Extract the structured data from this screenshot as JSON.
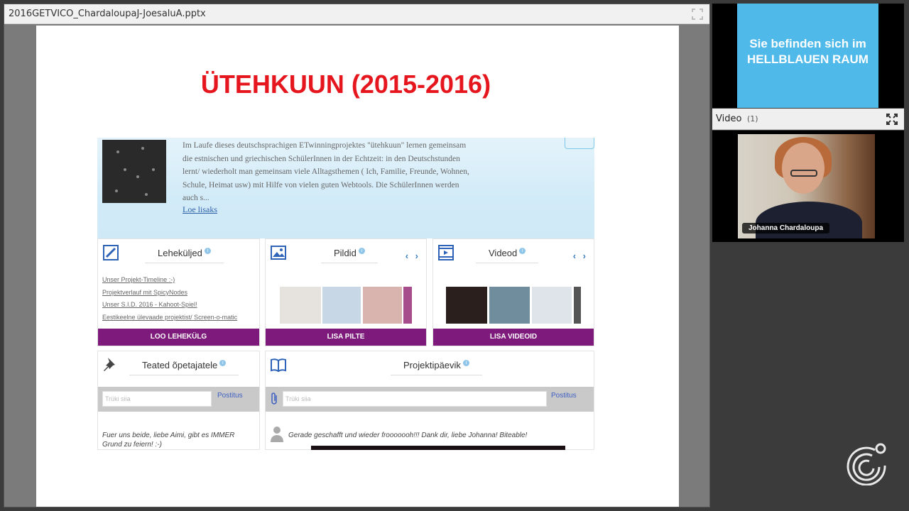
{
  "presentation": {
    "filename": "2016GETVICO_ChardaloupaJ-JoesaluA.pptx",
    "slide_title": "ÜTEHKUUN (2015-2016)"
  },
  "webpage": {
    "description": "Im Laufe dieses deutschsprachigen ETwinningprojektes \"ütehkuun\" lernen gemeinsam die estnischen und griechischen SchülerInnen in der Echtzeit: in den Deutschstunden lernt/ wiederholt man gemeinsam viele Alltagsthemen ( Ich, Familie, Freunde, Wohnen, Schule, Heimat usw) mit Hilfe von vielen guten Webtools. Die SchülerInnen werden auch s...",
    "read_more": "Loe lisaks",
    "pages_card": {
      "heading": "Leheküljed",
      "links": [
        "Unser Projekt-Timeline :-)",
        "Projektverlauf mit SpicyNodes",
        "Unser S.I.D. 2016 - Kahoot-Spiel!",
        "Eestikeelne ülevaade projektist/ Screen-o-matic"
      ],
      "button": "LOO LEHEKÜLG"
    },
    "images_card": {
      "heading": "Pildid",
      "button": "LISA PILTE",
      "nav": "‹ ›"
    },
    "videos_card": {
      "heading": "Videod",
      "button": "LISA VIDEOID",
      "nav": "‹ ›"
    },
    "teachers_card": {
      "heading": "Teated õpetajatele",
      "placeholder": "Trüki siia",
      "post": "Postitus",
      "comment": "Fuer uns beide, liebe Aimi, gibt es IMMER Grund zu feiern! :-)"
    },
    "diary_card": {
      "heading": "Projektipäevik",
      "placeholder": "Trüki siia",
      "post": "Postitus",
      "comment": "Gerade geschafft und wieder frooooooh!!! Dank dir, liebe Johanna! Biteable!"
    },
    "info_mark": "i"
  },
  "room_notice": {
    "line1": "Sie befinden sich im",
    "line2": "HELLBLAUEN RAUM",
    "color": "#4fb9e9"
  },
  "video_panel": {
    "title": "Video",
    "count": "(1)",
    "participant": "Johanna Chardaloupa"
  },
  "colors": {
    "title_red": "#e5161d",
    "purple": "#7d1a7b"
  }
}
